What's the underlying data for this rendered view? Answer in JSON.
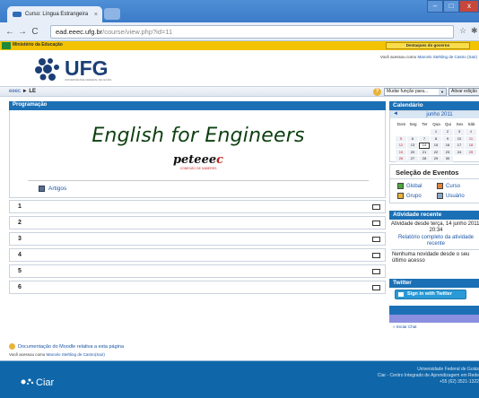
{
  "browser": {
    "tab_title": "Curso: Língua Estrangeira",
    "tab_close": "×",
    "url_host": "ead.eeec.ufg.br",
    "url_path": "/course/view.php?id=11",
    "back": "←",
    "forward": "→",
    "reload": "C",
    "star": "☆",
    "wrench": "✱",
    "min": "–",
    "max": "□",
    "close": "x"
  },
  "gov": {
    "label": "Ministério da Educação",
    "button": "Destaques do governo"
  },
  "header": {
    "logo_text": "UFG",
    "logo_sub": "UNIVERSIDADE FEDERAL DE GOIÁS",
    "logged_prefix": "Você acessou como",
    "logged_user": "Marcelo Stehling de Castro",
    "logged_suffix": "(Sair)"
  },
  "breadcrumb": {
    "root": "eeec",
    "sep": "►",
    "current": "LE"
  },
  "toolbar": {
    "help": "?",
    "role_select": "Mudar função para...",
    "edit_button": "Ativar edição"
  },
  "main": {
    "section_header": "Programação",
    "course_title": "English for Engineers",
    "pet_logo_a": "peteee",
    "pet_logo_b": "c",
    "pet_logo_sub": "CONEXÃO DE SABERES",
    "resource_label": "Artigos",
    "topics": [
      "1",
      "2",
      "3",
      "4",
      "5",
      "6"
    ],
    "doc_link": "Documentação do Moodle relativa a esta página",
    "logged_prefix": "Você acessou como",
    "logged_user": "Marcelo Stehling de Castro",
    "logged_suffix": "(Sair)"
  },
  "calendar": {
    "header": "Calendário",
    "prev": "◄",
    "month": "junho 2011",
    "dows": [
      "Dom",
      "Seg",
      "Ter",
      "Qua",
      "Qui",
      "Sex",
      "Sáb"
    ],
    "weeks": [
      [
        "",
        "",
        "",
        "1",
        "2",
        "3",
        "4"
      ],
      [
        "5",
        "6",
        "7",
        "8",
        "9",
        "10",
        "11"
      ],
      [
        "12",
        "13",
        "14",
        "15",
        "16",
        "17",
        "18"
      ],
      [
        "19",
        "20",
        "21",
        "22",
        "23",
        "24",
        "25"
      ],
      [
        "26",
        "27",
        "28",
        "29",
        "30",
        "",
        ""
      ]
    ],
    "today": "14"
  },
  "events": {
    "header": "Seleção de Eventos",
    "items": [
      "Global",
      "Curso",
      "Grupo",
      "Usuário"
    ],
    "colors": [
      "#4aa83b",
      "#e0833b",
      "#e9b23a",
      "#8aa8c8"
    ]
  },
  "activity": {
    "header": "Atividade recente",
    "since": "Atividade desde terça, 14 junho 2011, 20:34",
    "report": "Relatório completo da atividade recente",
    "none": "Nenhuma novidade desde o seu último acesso"
  },
  "twitter": {
    "header": "Twitter",
    "button": "Sign in with Twitter"
  },
  "chat": {
    "link": "» Iniciar Chat"
  },
  "footer": {
    "brand": "Ciar",
    "line1": "Universidade Federal de Goiás",
    "line2": "Ciar - Centro Integrado de Aprendizagem em Rede",
    "line3": "+55 (62) 3521-1322"
  }
}
